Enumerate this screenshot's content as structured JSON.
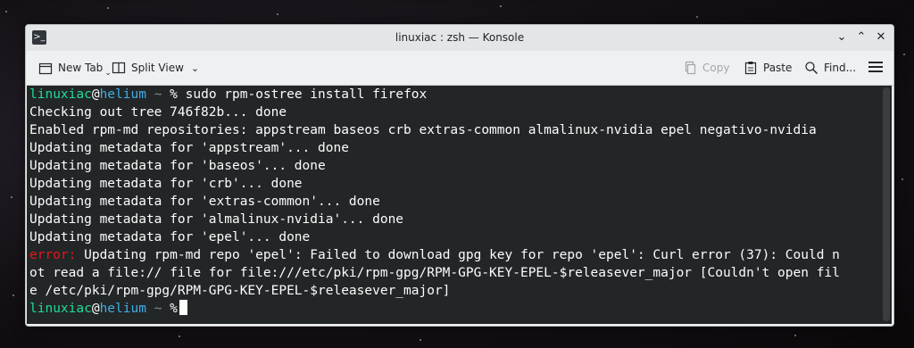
{
  "window": {
    "title": "linuxiac : zsh — Konsole"
  },
  "toolbar": {
    "new_tab": "New Tab",
    "split_view": "Split View",
    "copy": "Copy",
    "paste": "Paste",
    "find": "Find..."
  },
  "terminal": {
    "prompt": {
      "user": "linuxiac",
      "at": "@",
      "host": "helium",
      "path": " ~ ",
      "symbol": "%"
    },
    "command": " sudo rpm-ostree install firefox",
    "output": [
      "Checking out tree 746f82b... done",
      "Enabled rpm-md repositories: appstream baseos crb extras-common almalinux-nvidia epel negativo-nvidia",
      "Updating metadata for 'appstream'... done",
      "Updating metadata for 'baseos'... done",
      "Updating metadata for 'crb'... done",
      "Updating metadata for 'extras-common'... done",
      "Updating metadata for 'almalinux-nvidia'... done",
      "Updating metadata for 'epel'... done"
    ],
    "error_label": "error:",
    "error_lines": [
      " Updating rpm-md repo 'epel': Failed to download gpg key for repo 'epel': Curl error (37): Could n",
      "ot read a file:// file for file:///etc/pki/rpm-gpg/RPM-GPG-KEY-EPEL-$releasever_major [Couldn't open fil",
      "e /etc/pki/rpm-gpg/RPM-GPG-KEY-EPEL-$releasever_major]"
    ]
  },
  "colors": {
    "user": "#1cdc9a",
    "host": "#3daee9",
    "error": "#ed1515",
    "terminal_bg": "#232627",
    "terminal_fg": "#fcfcfc"
  }
}
